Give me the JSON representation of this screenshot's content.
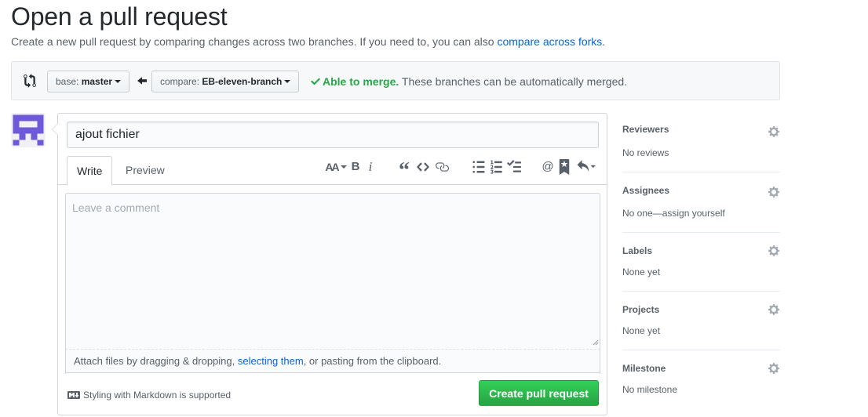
{
  "header": {
    "title": "Open a pull request",
    "subtitle_prefix": "Create a new pull request by comparing changes across two branches. If you need to, you can also ",
    "subtitle_link": "compare across forks",
    "subtitle_suffix": "."
  },
  "range": {
    "base_prefix": "base: ",
    "base_branch": "master",
    "compare_prefix": "compare: ",
    "compare_branch": "EB-eleven-branch",
    "merge_ok": "Able to merge.",
    "merge_text": " These branches can be automatically merged."
  },
  "form": {
    "title_value": "ajout fichier",
    "tabs": [
      {
        "label": "Write"
      },
      {
        "label": "Preview"
      }
    ],
    "comment_placeholder": "Leave a comment",
    "attach_prefix": "Attach files by dragging & dropping, ",
    "attach_link": "selecting them",
    "attach_suffix": ", or pasting from the clipboard.",
    "markdown_hint": "Styling with Markdown is supported",
    "submit_label": "Create pull request",
    "toolbar": {
      "heading": "AA",
      "bold": "B",
      "italic": "i",
      "quote": "“",
      "code": "<>",
      "mention": "@"
    }
  },
  "sidebar": [
    {
      "heading": "Reviewers",
      "value": "No reviews"
    },
    {
      "heading": "Assignees",
      "value": "No one—assign yourself"
    },
    {
      "heading": "Labels",
      "value": "None yet"
    },
    {
      "heading": "Projects",
      "value": "None yet"
    },
    {
      "heading": "Milestone",
      "value": "No milestone"
    }
  ],
  "colors": {
    "accent_link": "#0366d6",
    "success": "#28a745",
    "avatar": "#6e5ad8"
  },
  "icons": [
    "git-compare-icon",
    "arrow-left-icon",
    "check-icon",
    "avatar-identicon",
    "text-size-icon",
    "bold-icon",
    "italic-icon",
    "quote-icon",
    "code-icon",
    "link-icon",
    "list-unordered-icon",
    "list-ordered-icon",
    "tasklist-icon",
    "mention-icon",
    "bookmark-icon",
    "reply-icon",
    "markdown-icon",
    "gear-icon"
  ]
}
